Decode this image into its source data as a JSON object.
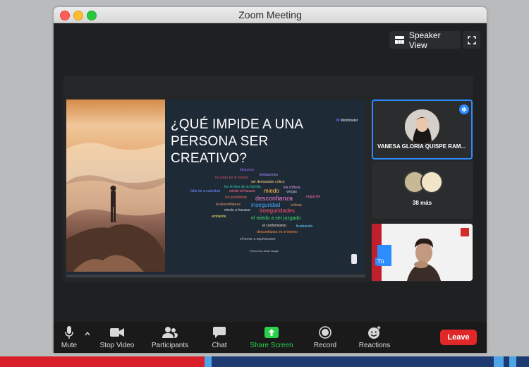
{
  "window": {
    "title": "Zoom Meeting"
  },
  "top_controls": {
    "speaker_view": "Speaker View",
    "fullscreen_icon": "fullscreen-icon"
  },
  "shared_slide": {
    "title": "¿QUÉ IMPIDE A UNA PERSONA SER CREATIVO?",
    "brand": "Mentimeter",
    "footer": "Press S to show image",
    "words": [
      {
        "text": "bloqueos",
        "color": "#9b6cf0"
      },
      {
        "text": "limitaciones",
        "color": "#b28ef8"
      },
      {
        "text": "no creer en sí mismo",
        "color": "#d4546a"
      },
      {
        "text": "ser demasiado crítico",
        "color": "#ffd07a"
      },
      {
        "text": "los límites de su familia",
        "color": "#2fd1b0"
      },
      {
        "text": "los críticos",
        "color": "#f6a1ff"
      },
      {
        "text": "falta de creatividad",
        "color": "#6e8cff"
      },
      {
        "text": "miedo al fracaso",
        "color": "#ff6d86"
      },
      {
        "text": "miedo",
        "color": "#ffc24b"
      },
      {
        "text": "vergas",
        "color": "#c4cfe0"
      },
      {
        "text": "los problemas",
        "color": "#e66b57"
      },
      {
        "text": "desconfianza",
        "color": "#f07fd3"
      },
      {
        "text": "la desconfianza",
        "color": "#f29a6c"
      },
      {
        "text": "inseguridad",
        "color": "#44a6ff"
      },
      {
        "text": "miedo a fracasar",
        "color": "#d1d6de"
      },
      {
        "text": "críticas",
        "color": "#e7a05b"
      },
      {
        "text": "inseguridades",
        "color": "#ff4d6d"
      },
      {
        "text": "ambiente",
        "color": "#ffe16a"
      },
      {
        "text": "el miedo a ser juzgado",
        "color": "#3ee06f"
      },
      {
        "text": "el conformismo",
        "color": "#f8e7d2"
      },
      {
        "text": "desconfianza en sí mismo",
        "color": "#ff8d3b"
      },
      {
        "text": "el temor a equivocarse",
        "color": "#b7b7c7"
      },
      {
        "text": "negación",
        "color": "#ff6ba1"
      },
      {
        "text": "frustración",
        "color": "#6ad3ff"
      }
    ]
  },
  "participants": {
    "active_name": "VANESA GLORIA QUISPE RAM...",
    "more_label": "38 más",
    "self_label": "Tú"
  },
  "toolbar": {
    "mute": "Mute",
    "stop_video": "Stop Video",
    "participants": "Participants",
    "chat": "Chat",
    "share_screen": "Share Screen",
    "record": "Record",
    "reactions": "Reactions",
    "leave": "Leave"
  },
  "colors": {
    "share_green": "#2bd14b",
    "leave_red": "#e02828",
    "accent_blue": "#2d8cff"
  }
}
